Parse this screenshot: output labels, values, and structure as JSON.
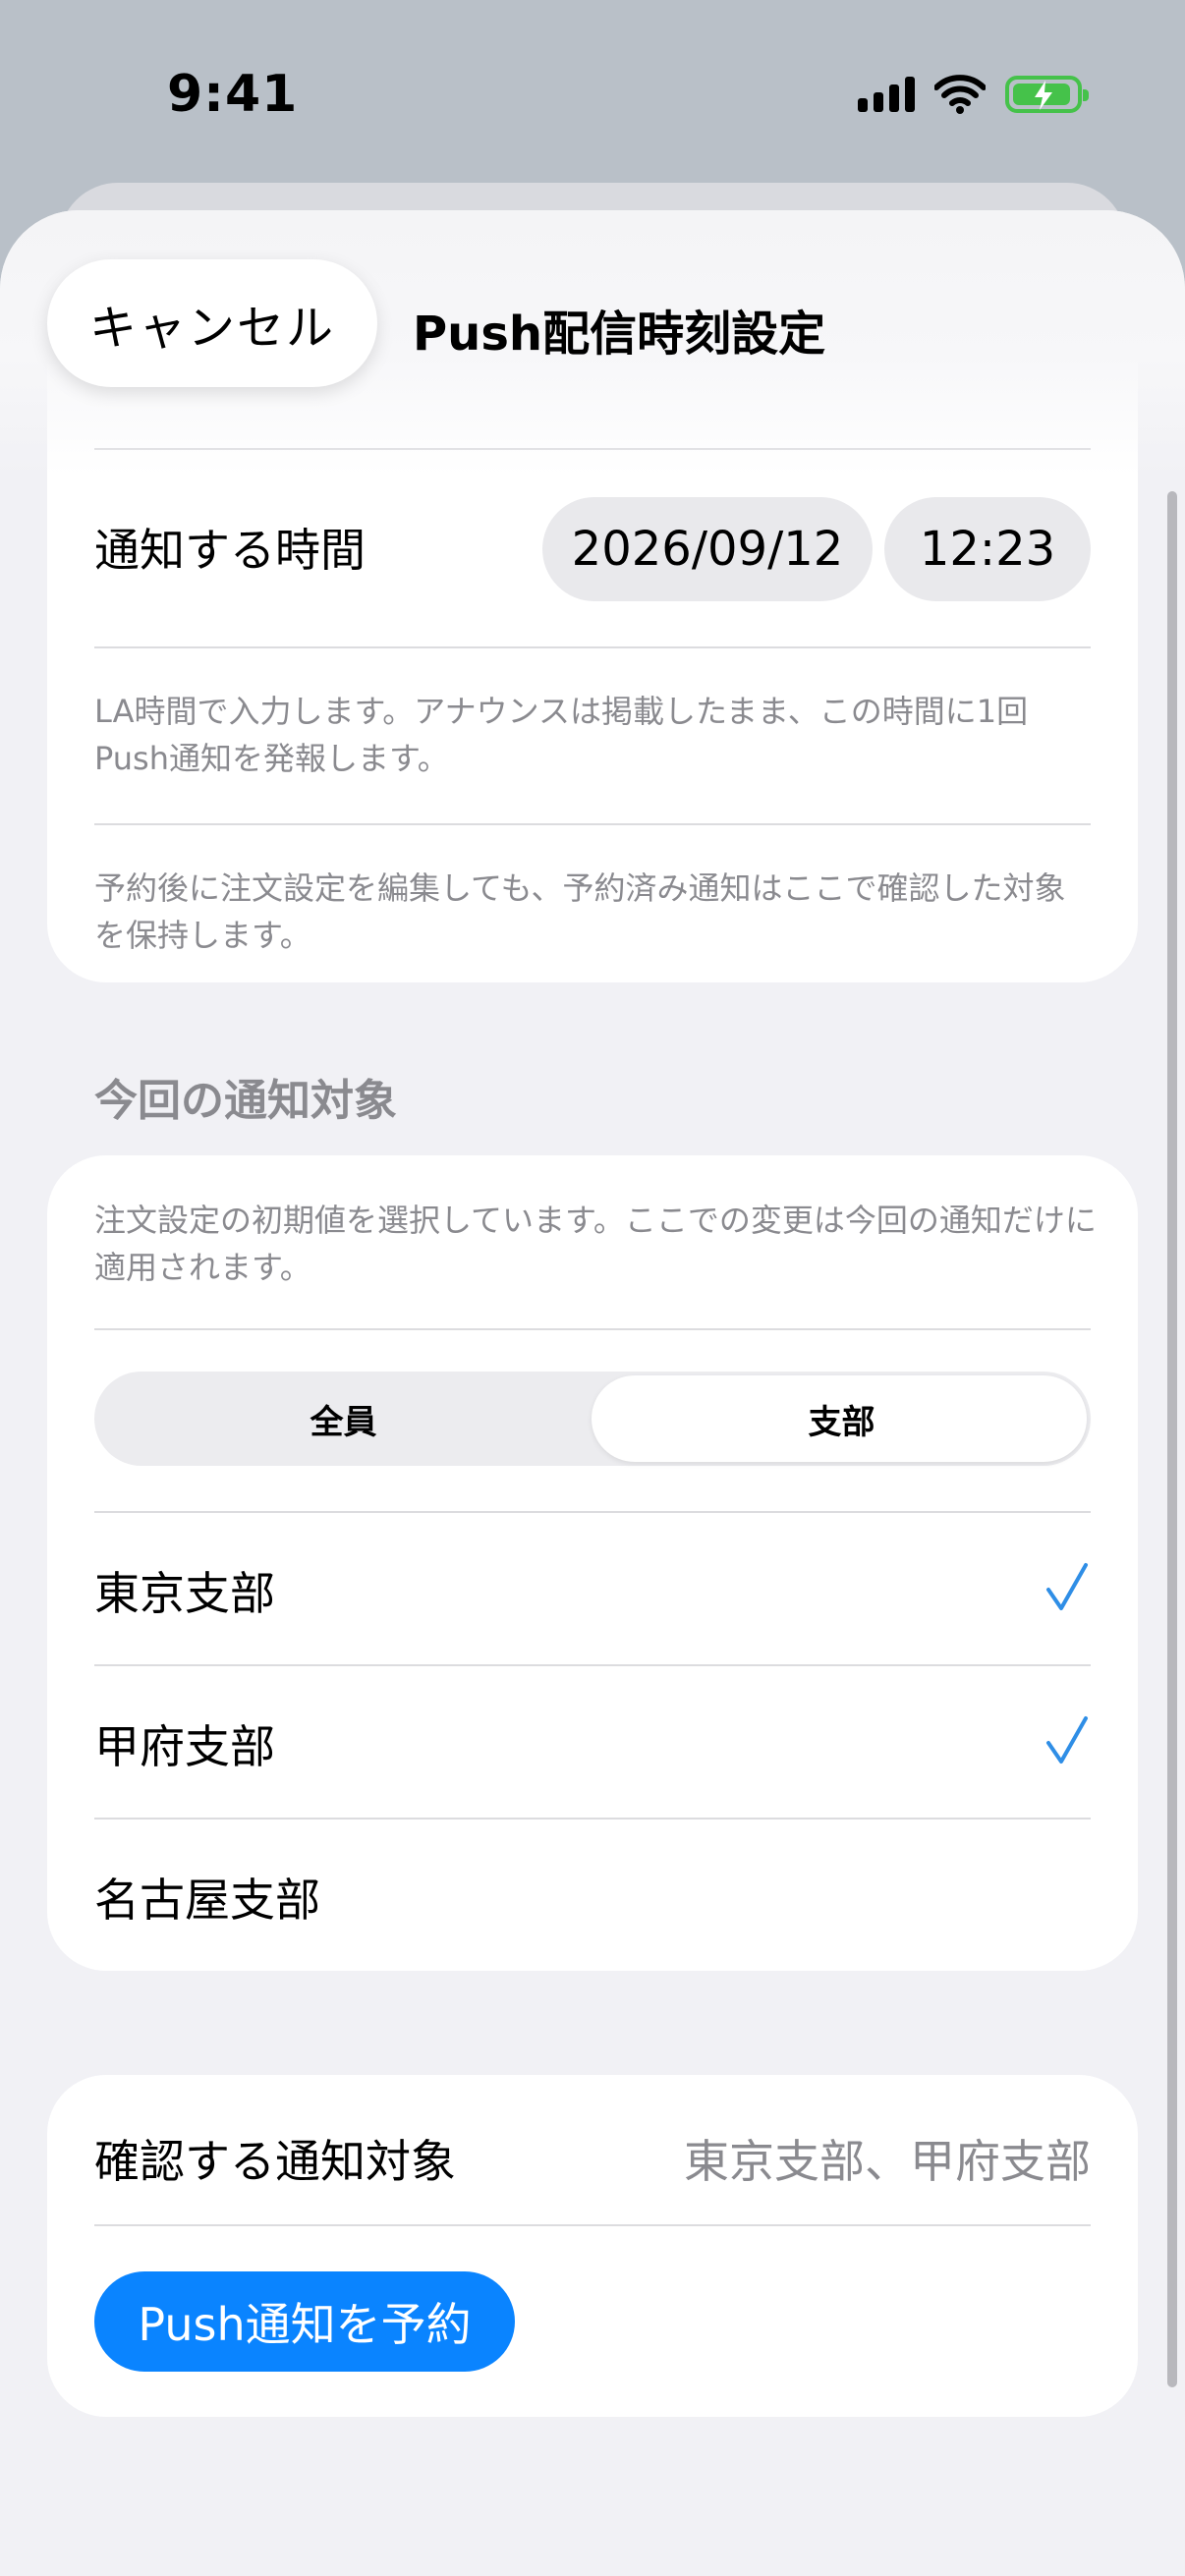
{
  "status_bar": {
    "time": "9:41"
  },
  "nav": {
    "cancel_label": "キャンセル",
    "title": "Push配信時刻設定"
  },
  "schedule": {
    "time_label": "通知する時間",
    "date_value": "2026/09/12",
    "time_value": "12:23",
    "note_la": "LA時間で入力します。アナウンスは掲載したまま、この時間に1回Push通知を発報します。",
    "note_keep": "予約後に注文設定を編集しても、予約済み通知はここで確認した対象を保持します。"
  },
  "targets": {
    "section_title": "今回の通知対象",
    "note": "注文設定の初期値を選択しています。ここでの変更は今回の通知だけに適用されます。",
    "segments": [
      "全員",
      "支部"
    ],
    "selected_segment": "支部",
    "branches": [
      {
        "label": "東京支部",
        "checked": true
      },
      {
        "label": "甲府支部",
        "checked": true
      },
      {
        "label": "名古屋支部",
        "checked": false
      }
    ]
  },
  "confirm": {
    "label": "確認する通知対象",
    "value": "東京支部、甲府支部",
    "submit_label": "Push通知を予約"
  },
  "colors": {
    "accent": "#0a84ff",
    "check": "#2f8ee6",
    "secondary_text": "#8a8a8f",
    "battery": "#45c24a"
  }
}
